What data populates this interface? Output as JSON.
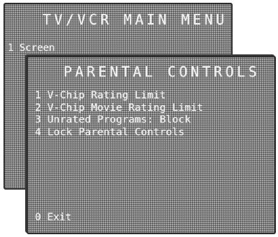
{
  "main_menu": {
    "title": "TV/VCR MAIN MENU",
    "items": [
      "1 Screen"
    ]
  },
  "parental_controls": {
    "title": "PARENTAL CONTROLS",
    "items": [
      "1 V-Chip Rating Limit",
      "2 V-Chip Movie Rating Limit",
      "3 Unrated Programs: Block",
      "4 Lock Parental Controls"
    ],
    "exit_label": "0 Exit"
  }
}
